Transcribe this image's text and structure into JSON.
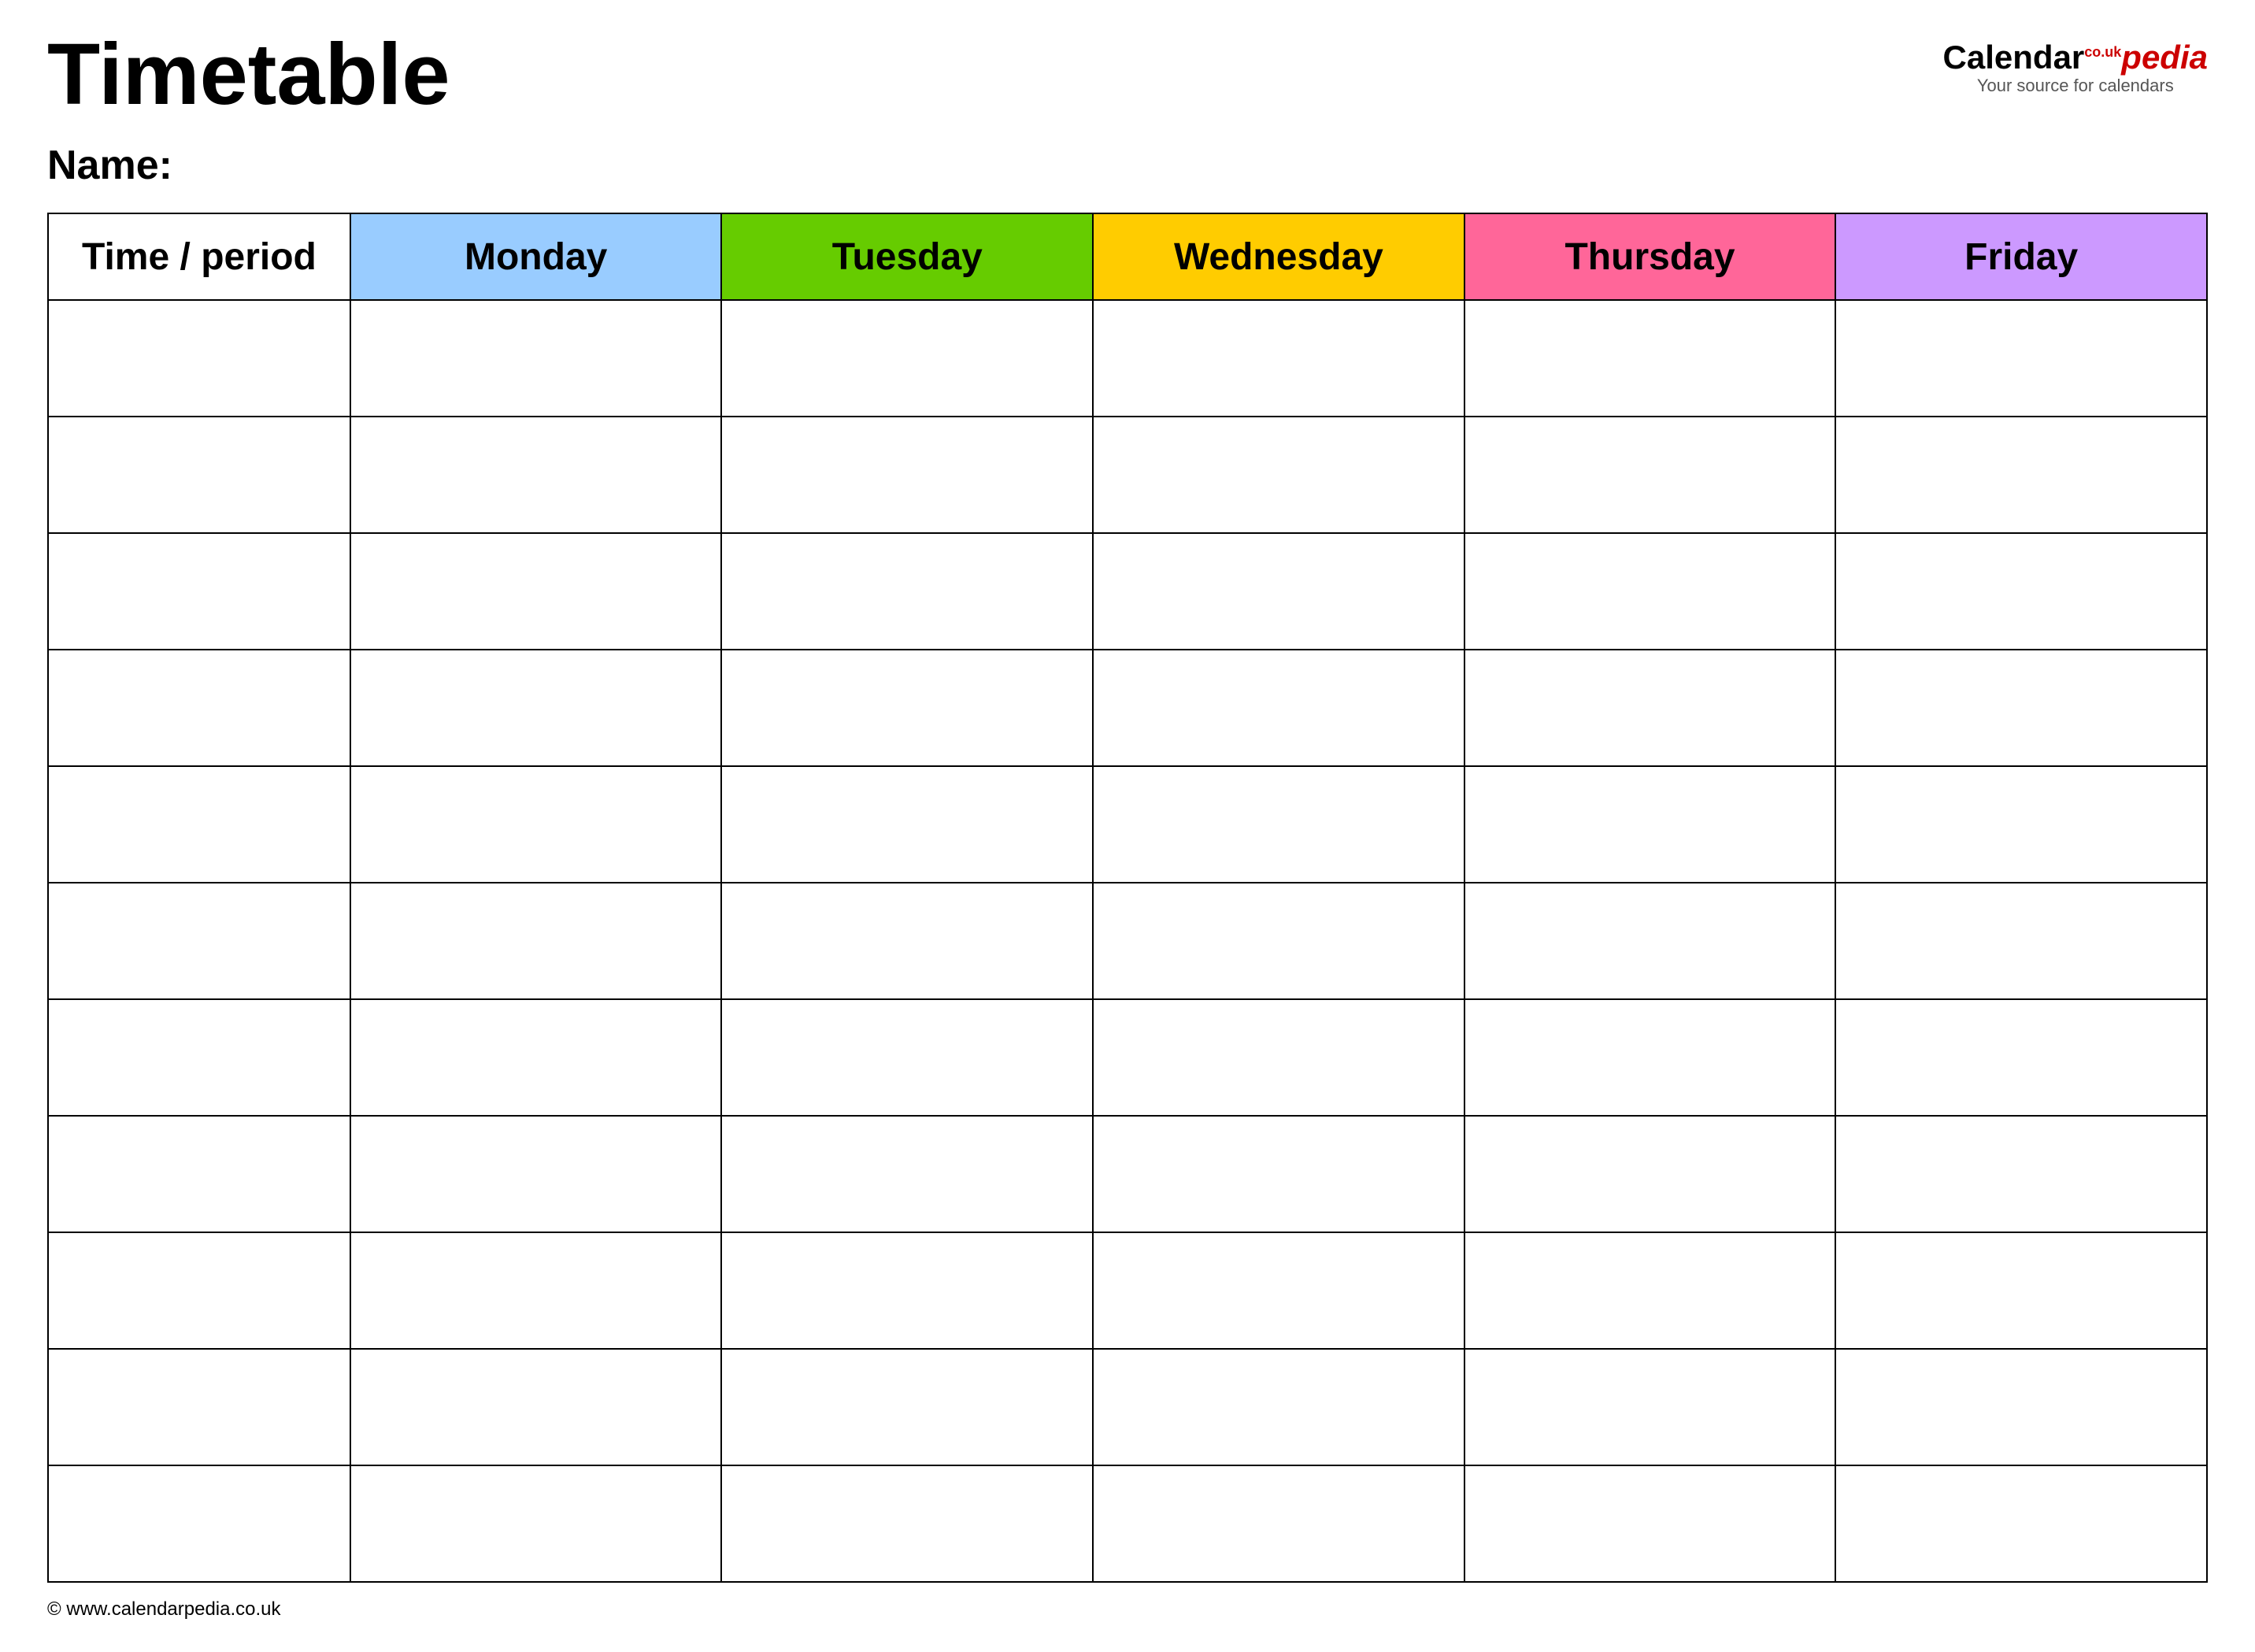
{
  "header": {
    "title": "Timetable",
    "logo": {
      "calendar": "Calendar",
      "co_uk": "co.uk",
      "pedia": "pedia",
      "subtitle": "Your source for calendars"
    }
  },
  "name_label": "Name:",
  "columns": {
    "time": "Time / period",
    "monday": "Monday",
    "tuesday": "Tuesday",
    "wednesday": "Wednesday",
    "thursday": "Thursday",
    "friday": "Friday"
  },
  "rows": 11,
  "footer": {
    "url": "www.calendarpedia.co.uk"
  }
}
